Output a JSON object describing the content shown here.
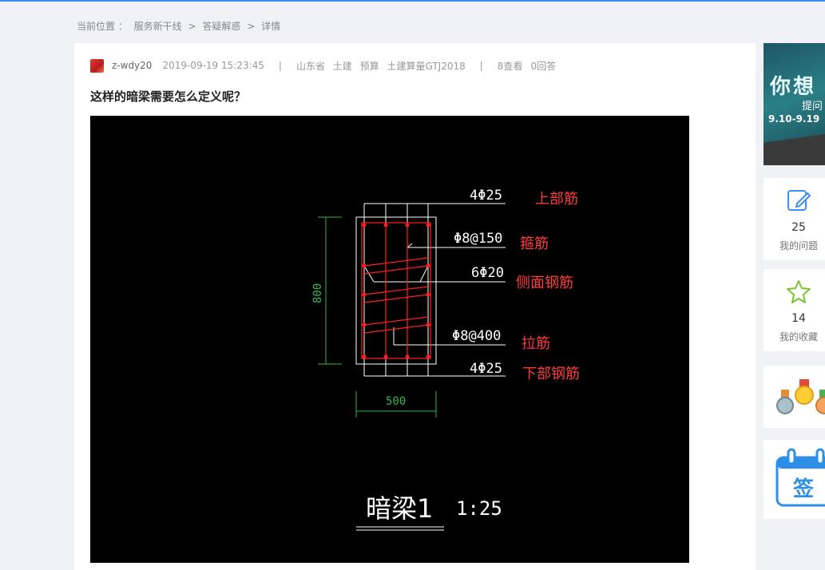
{
  "breadcrumb": {
    "prefix": "当前位置 ：",
    "items": [
      "服务新干线",
      "答疑解惑",
      "详情"
    ],
    "separator": ">"
  },
  "post": {
    "author": "z-wdy20",
    "time": "2019-09-19 15:23:45",
    "divider": "|",
    "tags": [
      "山东省",
      "土建",
      "预算",
      "土建算量GTJ2018"
    ],
    "views": "8查看",
    "answers": "0回答",
    "title": "这样的暗梁需要怎么定义呢？"
  },
  "drawing": {
    "labels": {
      "top_rebar_spec": "4Φ25",
      "top_rebar": "上部筋",
      "stirrup_spec": "Φ8@150",
      "stirrup": "箍筋",
      "side_spec": "6Φ20",
      "side": "侧面钢筋",
      "tie_spec": "Φ8@400",
      "tie": "拉筋",
      "bottom_spec": "4Φ25",
      "bottom": "下部钢筋",
      "height_dim": "800",
      "width_dim": "500",
      "beam_name": "暗梁1",
      "scale": "1:25"
    },
    "colors": {
      "background": "#000000",
      "outline": "#ffffff",
      "rebar": "#ff2020",
      "label": "#ff3b3b",
      "dimension": "#39b54a"
    }
  },
  "sidebar": {
    "banner": {
      "line1": "你想",
      "line2": "提问",
      "line3": "9.10-9.19"
    },
    "questions": {
      "count": "25",
      "label": "我的问题",
      "icon": "edit-icon"
    },
    "favorites": {
      "count": "14",
      "label": "我的收藏",
      "icon": "star-icon"
    },
    "ranking": {
      "icon": "medal-icon"
    },
    "checkin": {
      "label": "签",
      "icon": "calendar-icon"
    }
  },
  "accent_color": "#3c8ff5"
}
